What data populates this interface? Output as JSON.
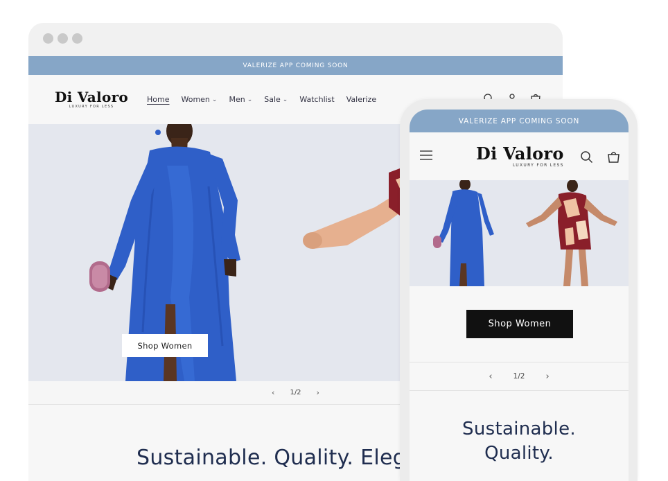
{
  "desktop": {
    "announcement": "VALERIZE APP COMING SOON",
    "logo": {
      "main": "Di Valoro",
      "tagline": "LUXURY FOR LESS"
    },
    "nav": [
      {
        "label": "Home",
        "active": true,
        "dropdown": false
      },
      {
        "label": "Women",
        "active": false,
        "dropdown": true
      },
      {
        "label": "Men",
        "active": false,
        "dropdown": true
      },
      {
        "label": "Sale",
        "active": false,
        "dropdown": true
      },
      {
        "label": "Watchlist",
        "active": false,
        "dropdown": false
      },
      {
        "label": "Valerize",
        "active": false,
        "dropdown": false
      }
    ],
    "header_icons": [
      "search-icon",
      "account-icon",
      "cart-icon"
    ],
    "hero_button": "Shop Women",
    "slider": {
      "prev": "‹",
      "counter": "1/2",
      "next": "›"
    },
    "section_heading": "Sustainable. Quality. Eleg"
  },
  "mobile": {
    "announcement": "VALERIZE APP COMING SOON",
    "logo": {
      "main": "Di Valoro",
      "tagline": "LUXURY FOR LESS"
    },
    "header_icons": [
      "menu-icon",
      "search-icon",
      "cart-icon"
    ],
    "hero_button": "Shop Women",
    "slider": {
      "prev": "‹",
      "counter": "1/2",
      "next": "›"
    },
    "section_heading": [
      "Sustainable.",
      "Quality."
    ]
  },
  "colors": {
    "announcement_bg": "#86a6c7",
    "heading_text": "#1f2d4f",
    "dress_blue": "#2f5fc8",
    "floral_red": "#8a1f2a"
  }
}
